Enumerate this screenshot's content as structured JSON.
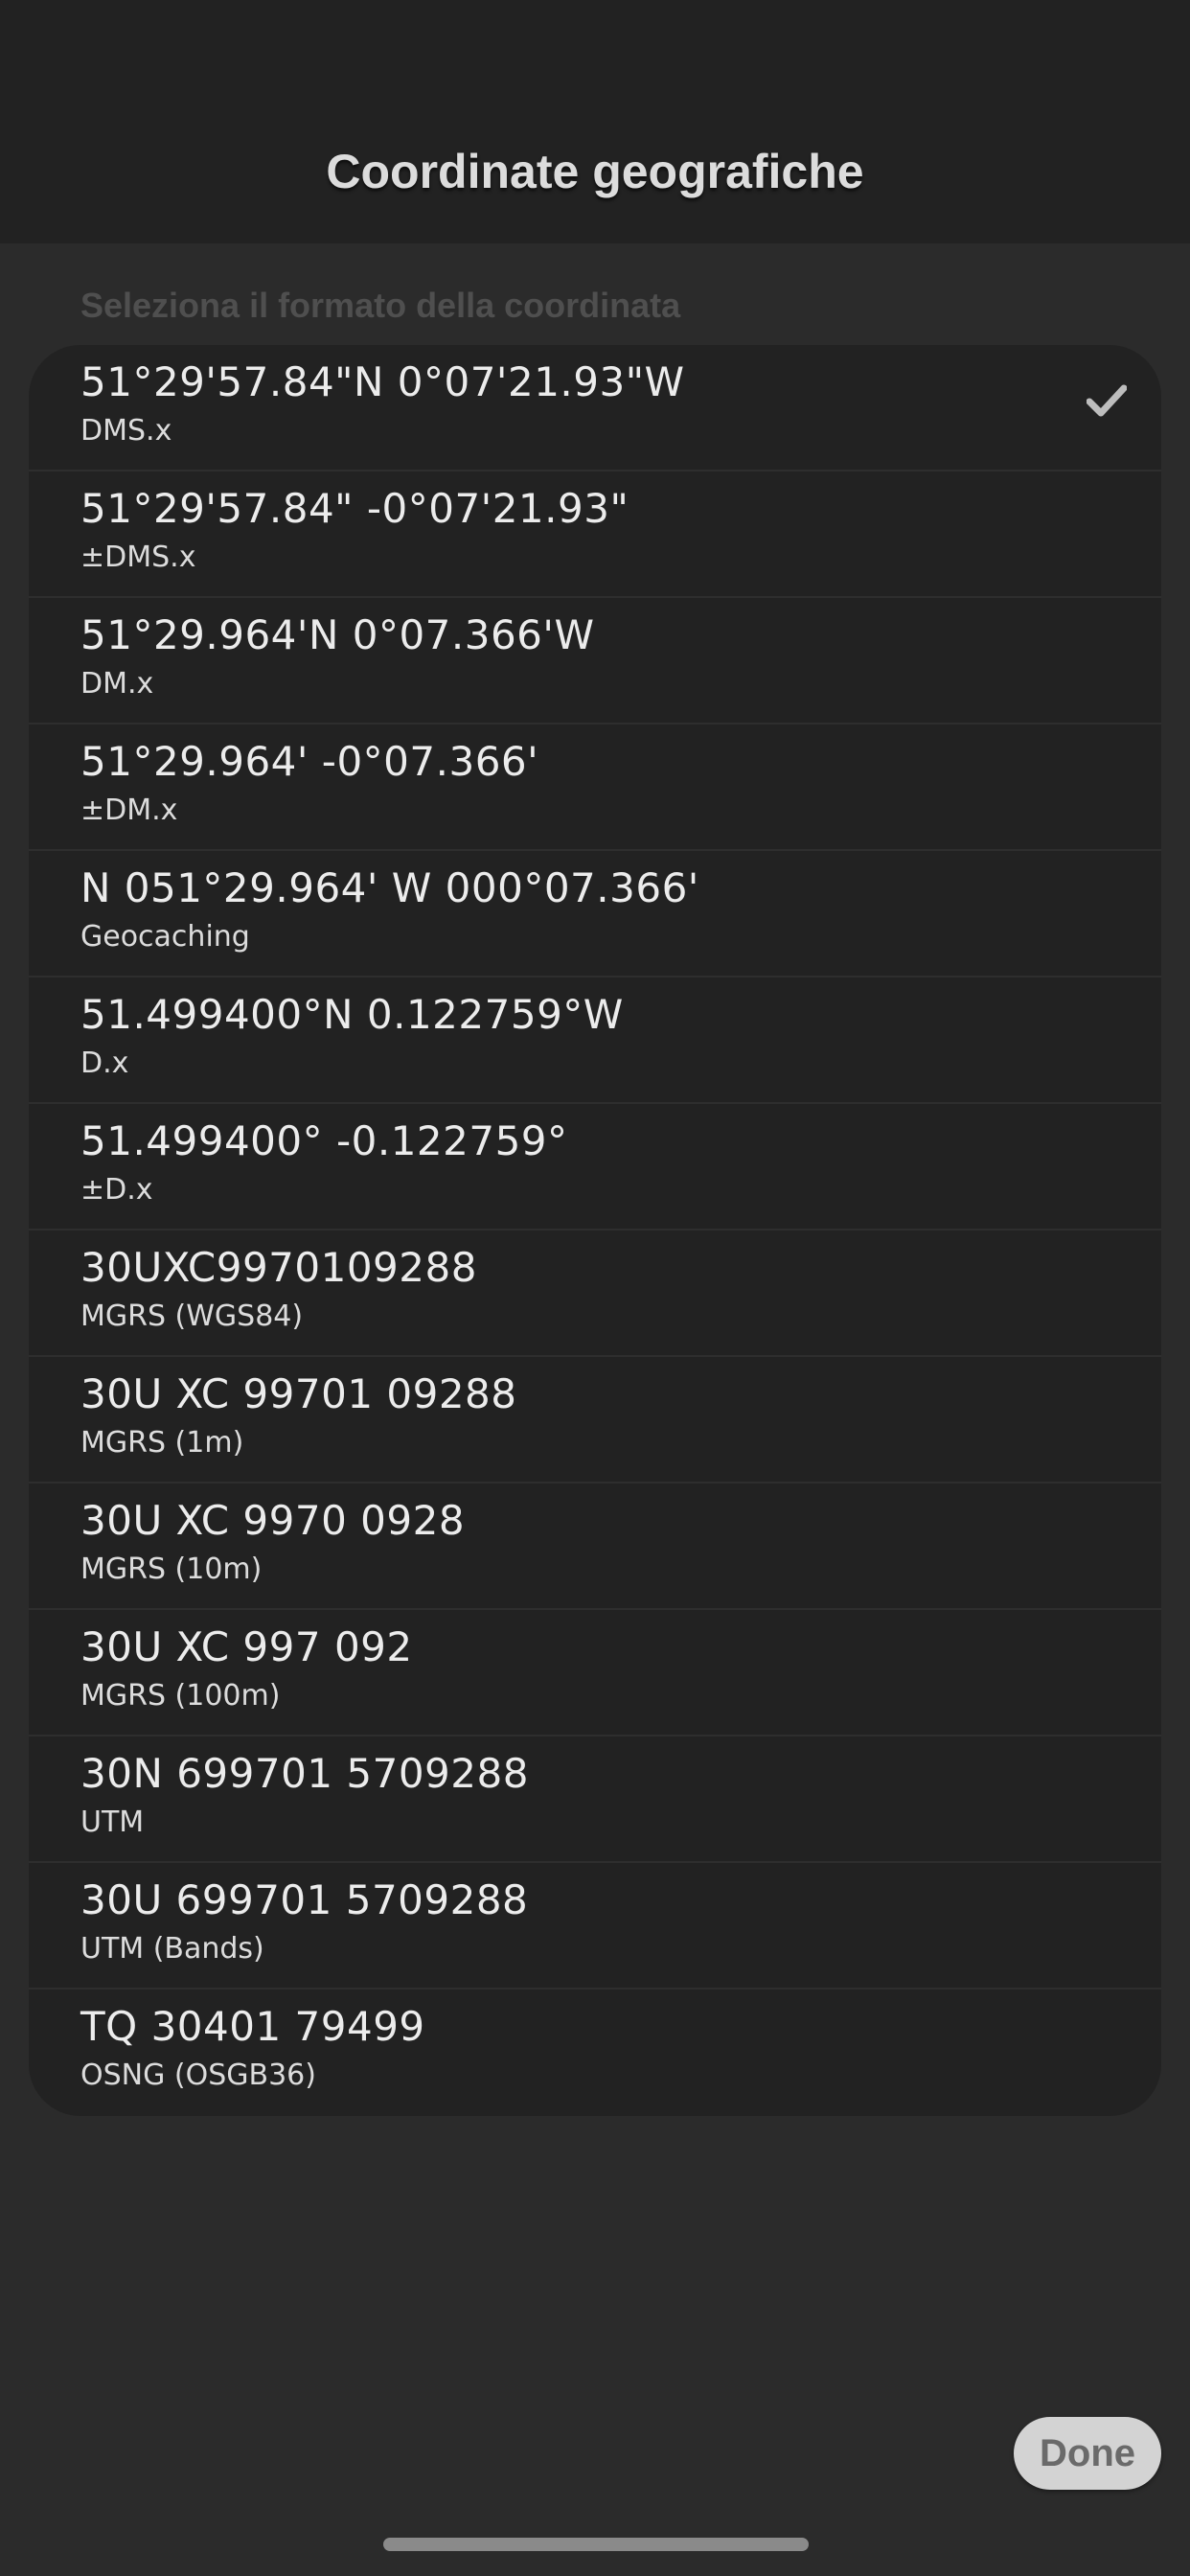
{
  "header": {
    "title": "Coordinate geografiche"
  },
  "section": {
    "label": "Seleziona il formato della coordinata"
  },
  "formats": [
    {
      "value": "51°29'57.84\"N 0°07'21.93\"W",
      "format": "DMS.x",
      "selected": true
    },
    {
      "value": "51°29'57.84\" -0°07'21.93\"",
      "format": "±DMS.x",
      "selected": false
    },
    {
      "value": "51°29.964'N 0°07.366'W",
      "format": "DM.x",
      "selected": false
    },
    {
      "value": "51°29.964' -0°07.366'",
      "format": "±DM.x",
      "selected": false
    },
    {
      "value": "N 051°29.964' W 000°07.366'",
      "format": "Geocaching",
      "selected": false
    },
    {
      "value": "51.499400°N 0.122759°W",
      "format": "D.x",
      "selected": false
    },
    {
      "value": "51.499400° -0.122759°",
      "format": "±D.x",
      "selected": false
    },
    {
      "value": "30UXC9970109288",
      "format": "MGRS (WGS84)",
      "selected": false
    },
    {
      "value": "30U XC 99701 09288",
      "format": "MGRS (1m)",
      "selected": false
    },
    {
      "value": "30U XC 9970 0928",
      "format": "MGRS (10m)",
      "selected": false
    },
    {
      "value": "30U XC 997 092",
      "format": "MGRS (100m)",
      "selected": false
    },
    {
      "value": "30N 699701 5709288",
      "format": "UTM",
      "selected": false
    },
    {
      "value": "30U 699701 5709288",
      "format": "UTM (Bands)",
      "selected": false
    },
    {
      "value": "TQ 30401 79499",
      "format": "OSNG (OSGB36)",
      "selected": false
    }
  ],
  "footer": {
    "done_label": "Done"
  },
  "icons": {
    "selected": "checkmark-icon"
  },
  "colors": {
    "background": "#2b2b2b",
    "header_bg": "#222222",
    "list_bg": "#222222",
    "done_bg": "#d3d3d3"
  }
}
